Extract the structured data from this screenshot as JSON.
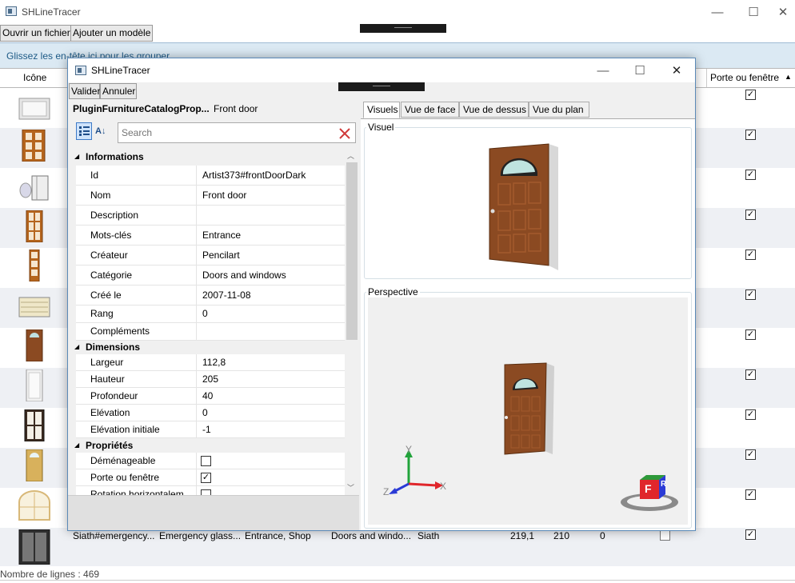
{
  "main_window": {
    "title": "SHLineTracer",
    "controls": {
      "minimize": "—",
      "maximize": "☐",
      "close": "✕"
    }
  },
  "toolbar": {
    "open_file": "Ouvrir un fichier",
    "add_model": "Ajouter un modèle"
  },
  "group_panel": {
    "hint": "Glissez les en-tête ici pour les grouper"
  },
  "grid": {
    "headers": {
      "icon": "Icône",
      "door_or_window": "Porte ou fenêtre",
      "sort_indicator": "▲"
    },
    "last_row": {
      "id": "Siath#emergency...",
      "name": "Emergency glass...",
      "keywords": "Entrance, Shop",
      "category": "Doors and windo...",
      "creator": "Siath",
      "width": "219,1",
      "height": "210",
      "depth": "0"
    },
    "door_window_checked": [
      true,
      true,
      true,
      true,
      true,
      true,
      true,
      true,
      true,
      true,
      true,
      true
    ],
    "footer": "Nombre de lignes : 469"
  },
  "dialog": {
    "title": "SHLineTracer",
    "controls": {
      "minimize": "—",
      "maximize": "☐",
      "close": "✕"
    },
    "buttons": {
      "validate": "Valider",
      "cancel": "Annuler"
    },
    "header": {
      "type": "PluginFurnitureCatalogProp...",
      "name": "Front door"
    },
    "search_placeholder": "Search",
    "categories": {
      "informations": "Informations",
      "dimensions": "Dimensions",
      "properties": "Propriétés"
    },
    "informations": [
      {
        "key": "Id",
        "value": "Artist373#frontDoorDark"
      },
      {
        "key": "Nom",
        "value": "Front door"
      },
      {
        "key": "Description",
        "value": ""
      },
      {
        "key": "Mots-clés",
        "value": "Entrance"
      },
      {
        "key": "Créateur",
        "value": "Pencilart"
      },
      {
        "key": "Catégorie",
        "value": "Doors and windows"
      },
      {
        "key": "Créé le",
        "value": "2007-11-08"
      },
      {
        "key": "Rang",
        "value": "0"
      },
      {
        "key": "Compléments",
        "value": ""
      }
    ],
    "dimensions": [
      {
        "key": "Largeur",
        "value": "112,8"
      },
      {
        "key": "Hauteur",
        "value": "205"
      },
      {
        "key": "Profondeur",
        "value": "40"
      },
      {
        "key": "Elévation",
        "value": "0"
      },
      {
        "key": "Elévation initiale",
        "value": "-1"
      }
    ],
    "properties": [
      {
        "key": "Déménageable",
        "checked": false
      },
      {
        "key": "Porte ou fenêtre",
        "checked": true
      },
      {
        "key": "Rotation horizontalem",
        "checked": false
      }
    ],
    "tabs": [
      "Visuels",
      "Vue de face",
      "Vue de dessus",
      "Vue du plan"
    ],
    "groups": {
      "visual": "Visuel",
      "perspective": "Perspective"
    },
    "axes": {
      "x": "X",
      "y": "Y",
      "z": "Z"
    },
    "cube": {
      "front": "F",
      "right": "R"
    }
  },
  "colors": {
    "door": "#8b4a22",
    "door_frame": "#d8d8d8",
    "axis_x": "#e0262b",
    "axis_y": "#21a33b",
    "axis_z": "#2b3bd6",
    "group_panel_bg": "#dbe9f3",
    "group_panel_text": "#1d5a86"
  }
}
